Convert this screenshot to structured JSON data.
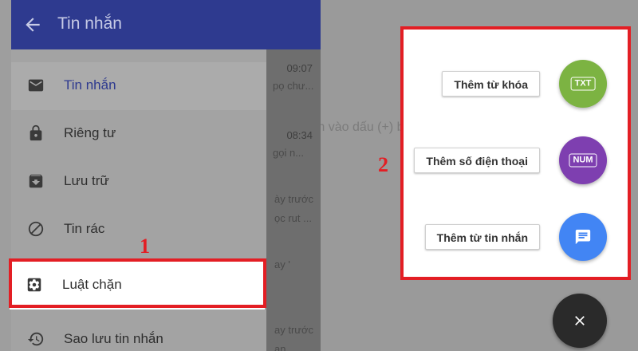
{
  "left": {
    "appbar": {
      "title": "Tin nhắn",
      "back_icon": "arrow-left-icon"
    },
    "drawer_items": [
      {
        "label": "Tin nhắn",
        "icon": "mail-icon",
        "active": true
      },
      {
        "label": "Riêng tư",
        "icon": "lock-icon"
      },
      {
        "label": "Lưu trữ",
        "icon": "archive-icon"
      },
      {
        "label": "Tin rác",
        "icon": "block-icon"
      },
      {
        "label": "Luật chặn",
        "icon": "gear-icon",
        "highlighted": true
      },
      {
        "label": "Sao lưu tin nhắn",
        "icon": "restore-icon"
      }
    ],
    "conversations": [
      {
        "time": "09:07",
        "preview": "pọ chư..."
      },
      {
        "time": "08:34",
        "preview": "gọi n..."
      }
    ],
    "fragments": [
      "ày trước",
      "ọc rut ...",
      "ay '",
      "ay trước",
      "ạn..."
    ],
    "step_label": "1"
  },
  "right": {
    "hint": "m vào dấu (+) bên dưới để tạo luật chặn.",
    "step_label": "2",
    "actions": [
      {
        "label": "Thêm từ khóa",
        "fab_text": "TXT",
        "color": "#7cb342"
      },
      {
        "label": "Thêm số điện thoại",
        "fab_text": "NUM",
        "color": "#7e3fb0"
      },
      {
        "label": "Thêm từ tin nhắn",
        "fab_icon": "message-icon",
        "color": "#4285f4"
      }
    ],
    "close_icon": "close-icon"
  },
  "colors": {
    "accent": "#e31e24",
    "appbar": "#2e3a8f"
  }
}
